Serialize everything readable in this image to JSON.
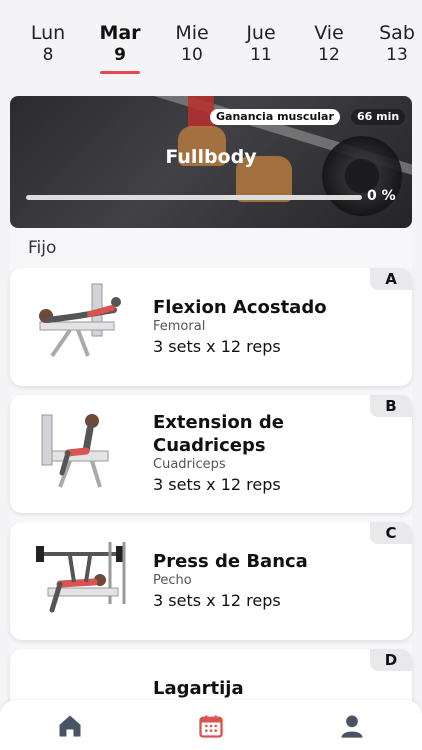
{
  "days": [
    {
      "name": "Lun",
      "num": "8"
    },
    {
      "name": "Mar",
      "num": "9"
    },
    {
      "name": "Mie",
      "num": "10"
    },
    {
      "name": "Jue",
      "num": "11"
    },
    {
      "name": "Vie",
      "num": "12"
    },
    {
      "name": "Sab",
      "num": "13"
    }
  ],
  "selected_day": "Mar",
  "hero": {
    "badge": "Ganancia muscular",
    "duration": "66 min",
    "title": "Fullbody",
    "progress_label": "0 %",
    "progress": 0
  },
  "section": "Fijo",
  "exercises": [
    {
      "letter": "A",
      "title": "Flexion Acostado",
      "muscle": "Femoral",
      "sets": "3 sets x 12 reps"
    },
    {
      "letter": "B",
      "title": "Extension de Cuadriceps",
      "muscle": "Cuadriceps",
      "sets": "3 sets x 12 reps"
    },
    {
      "letter": "C",
      "title": "Press de Banca",
      "muscle": "Pecho",
      "sets": "3 sets x 12 reps"
    },
    {
      "letter": "D",
      "title": "Lagartija",
      "muscle": "",
      "sets": ""
    }
  ],
  "nav": {
    "home_icon": "home-icon",
    "calendar_icon": "calendar-icon",
    "profile_icon": "user-icon"
  },
  "colors": {
    "accent": "#e04a4a",
    "calendar": "#d9534f"
  }
}
